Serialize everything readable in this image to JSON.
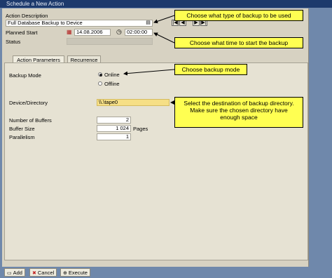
{
  "window": {
    "title": "Schedule a New Action"
  },
  "form": {
    "action_description_label": "Action Description",
    "action_description_value": "Full Database Backup to Device",
    "planned_start_label": "Planned Start",
    "planned_date": "14.08.2006",
    "planned_time": "02:00:00",
    "status_label": "Status",
    "status_value": ""
  },
  "tabs": [
    {
      "label": "Action Parameters",
      "active": true
    },
    {
      "label": "Recurrence",
      "active": false
    }
  ],
  "params": {
    "backup_mode_label": "Backup Mode",
    "mode_online": "Online",
    "mode_offline": "Offline",
    "selected_mode": "Online",
    "device_label": "Device/Directory",
    "device_value": "\\\\.\\tape0",
    "buffers_label": "Number of Buffers",
    "buffers_value": "2",
    "buffer_size_label": "Buffer Size",
    "buffer_size_value": "1 024",
    "buffer_size_unit": "Pages",
    "parallelism_label": "Parallelism",
    "parallelism_value": "1"
  },
  "callouts": {
    "backup_type": "Choose what type of backup to be used",
    "start_time": "Choose what time to start the backup",
    "backup_mode": "Choose backup mode",
    "destination_line1": "Select the destination of backup directory.",
    "destination_line2": "Make sure the chosen directory have",
    "destination_line3": "enough space"
  },
  "toolbar": {
    "add": "Add",
    "cancel": "Cancel",
    "execute": "Execute"
  },
  "icons": {
    "add": "document-icon",
    "cancel": "cancel-x-icon",
    "execute": "execute-icon",
    "calendar": "calendar-icon",
    "clock": "clock-icon",
    "value_help": "value-help-icon"
  },
  "colors": {
    "window_bg": "#d7d2c2",
    "outer_bg": "#6f88ab",
    "callout_bg": "#ffff52",
    "input_highlight": "#f6df86",
    "title_bar": "#1d3a6c"
  }
}
